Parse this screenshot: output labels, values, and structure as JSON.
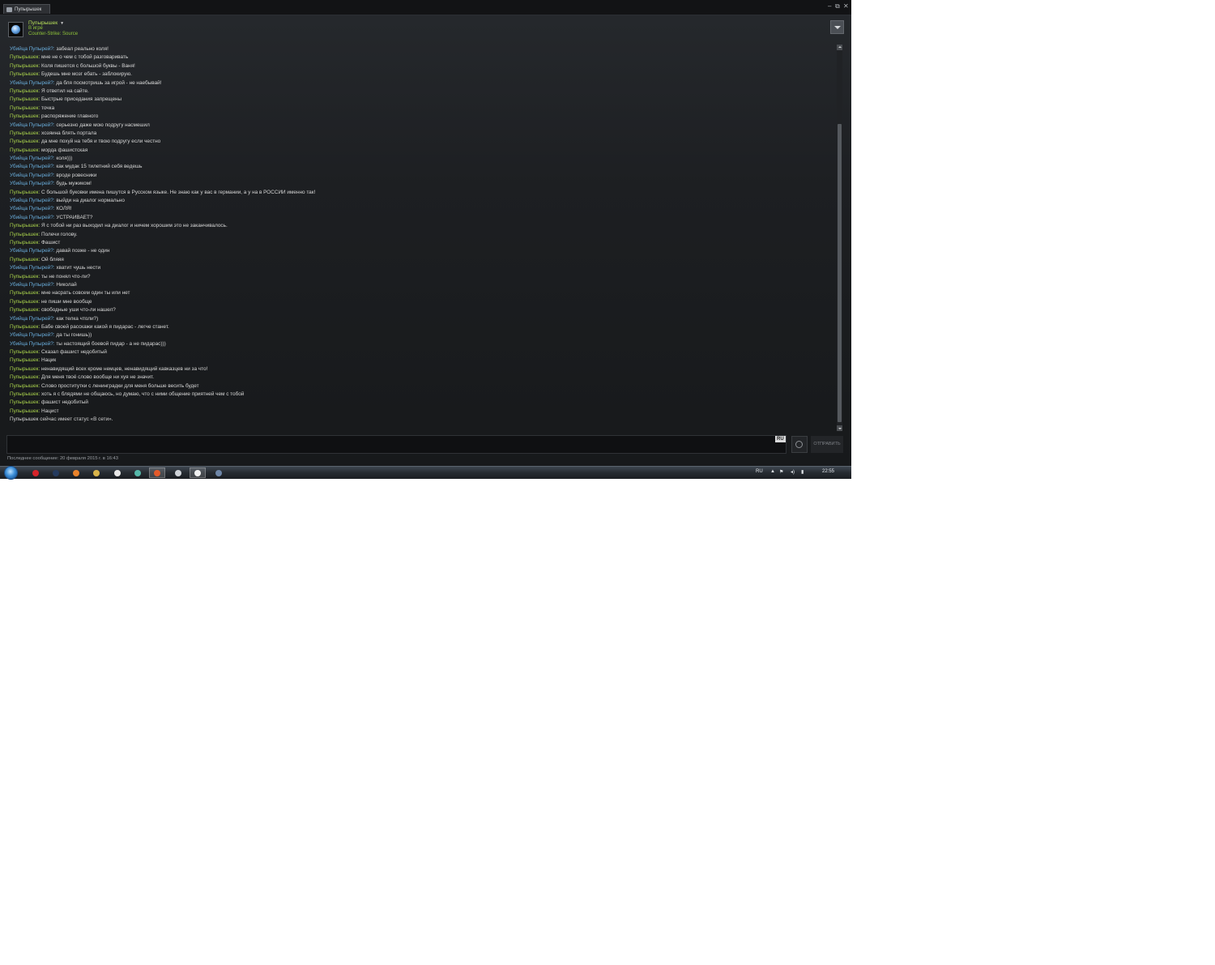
{
  "window": {
    "tab_title": "Пупырышек",
    "controls": {
      "minimize": "‒",
      "restore": "⧉",
      "close": "✕"
    }
  },
  "header": {
    "name": "Пупырышек",
    "status": "В игре",
    "game": "Counter-Strike: Source"
  },
  "colors": {
    "self_name": "#a7d04b",
    "friend_name": "#6aaedc",
    "message_text": "#d6d6d6",
    "background": "#1d1f22"
  },
  "messages": [
    {
      "type": "them",
      "sender": "Убийца Пупырей?",
      "text": "забеал реально коля!"
    },
    {
      "type": "me",
      "sender": "Пупырышек",
      "text": "мне не о чем с тобой разговаривать"
    },
    {
      "type": "me",
      "sender": "Пупырышек",
      "text": "Коля пишется с большой буквы - Ваня!"
    },
    {
      "type": "me",
      "sender": "Пупырышек",
      "text": "Будешь мне мозг ебать - заблокирую."
    },
    {
      "type": "them",
      "sender": "Убийца Пупырей?",
      "text": "да бля посмотришь за игрой - не наебывай!"
    },
    {
      "type": "me",
      "sender": "Пупырышек",
      "text": "Я ответил на сайте."
    },
    {
      "type": "me",
      "sender": "Пупырышек",
      "text": "Быстрые приседания запрещены"
    },
    {
      "type": "me",
      "sender": "Пупырышек",
      "text": "точка"
    },
    {
      "type": "me",
      "sender": "Пупырышек",
      "text": "распоряжение главного"
    },
    {
      "type": "them",
      "sender": "Убийца Пупырей?",
      "text": "серьезно даже мою подругу насмешил"
    },
    {
      "type": "me",
      "sender": "Пупырышек",
      "text": "хозяина блять портала"
    },
    {
      "type": "me",
      "sender": "Пупырышек",
      "text": "да мне похуй на тебя и твою подругу если честно"
    },
    {
      "type": "me",
      "sender": "Пупырышек",
      "text": "морда фашистская"
    },
    {
      "type": "them",
      "sender": "Убийца Пупырей?",
      "text": "коля)))"
    },
    {
      "type": "them",
      "sender": "Убийца Пупырей?",
      "text": "как мудак 15 тилетний себя ведешь"
    },
    {
      "type": "them",
      "sender": "Убийца Пупырей?",
      "text": "вроде ровесники"
    },
    {
      "type": "them",
      "sender": "Убийца Пупырей?",
      "text": "будь мужиком!"
    },
    {
      "type": "me",
      "sender": "Пупырышек",
      "text": "С большой буковки имена пишутся в Русском языке. Не знаю как у вас в германии, а у на в РОССИИ именно так!"
    },
    {
      "type": "them",
      "sender": "Убийца Пупырей?",
      "text": "выйди на диалог нормально"
    },
    {
      "type": "them",
      "sender": "Убийца Пупырей?",
      "text": "КОЛЯ!"
    },
    {
      "type": "them",
      "sender": "Убийца Пупырей?",
      "text": "УСТРАИВАЕТ?"
    },
    {
      "type": "me",
      "sender": "Пупырышек",
      "text": "Я с тобой ни раз выходил на диалог и ничем хорошим это не заканчивалось."
    },
    {
      "type": "me",
      "sender": "Пупырышек",
      "text": "Полечи голову."
    },
    {
      "type": "me",
      "sender": "Пупырышек",
      "text": "Фашист"
    },
    {
      "type": "them",
      "sender": "Убийца Пупырей?",
      "text": "давай позже - не один"
    },
    {
      "type": "me",
      "sender": "Пупырышек",
      "text": "Ой бляяя"
    },
    {
      "type": "them",
      "sender": "Убийца Пупырей?",
      "text": "хватит чушь нести"
    },
    {
      "type": "me",
      "sender": "Пупырышек",
      "text": "ты не понял что-ли?"
    },
    {
      "type": "them",
      "sender": "Убийца Пупырей?",
      "text": "Николай"
    },
    {
      "type": "me",
      "sender": "Пупырышек",
      "text": "мне насрать совсем один ты или нет"
    },
    {
      "type": "me",
      "sender": "Пупырышек",
      "text": "не пиши мне вообще"
    },
    {
      "type": "me",
      "sender": "Пупырышек",
      "text": "свободные уши что-ли нашел?"
    },
    {
      "type": "them",
      "sender": "Убийца Пупырей?",
      "text": "как телка чтоли?)"
    },
    {
      "type": "me",
      "sender": "Пупырышек",
      "text": "Бабе своей расскажи какой я пидарас - легче станет."
    },
    {
      "type": "them",
      "sender": "Убийца Пупырей?",
      "text": "да ты гонишь))"
    },
    {
      "type": "them",
      "sender": "Убийца Пупырей?",
      "text": "ты настоящий боевой пидар - а не пидарас)))"
    },
    {
      "type": "me",
      "sender": "Пупырышек",
      "text": "Сказал фашист недобитый"
    },
    {
      "type": "me",
      "sender": "Пупырышек",
      "text": "Нацик"
    },
    {
      "type": "me",
      "sender": "Пупырышек",
      "text": "ненавидящий всех кроме немцев, ненавидящий кавказцев ни за что!"
    },
    {
      "type": "me",
      "sender": "Пупырышек",
      "text": "Для меня твоё слово вообще ни хуя не значит."
    },
    {
      "type": "me",
      "sender": "Пупырышек",
      "text": "Слово проститутки с ленинградки для меня больше весить будет"
    },
    {
      "type": "me",
      "sender": "Пупырышек",
      "text": "хоть я с блядями не общаюсь, но думаю, что с ними общение приятней чем с тобой"
    },
    {
      "type": "me",
      "sender": "Пупырышек",
      "text": "фашист недобитый"
    },
    {
      "type": "me",
      "sender": "Пупырышек",
      "text": "Нацист"
    },
    {
      "type": "system",
      "sender": "",
      "text": "Пупырышек сейчас имеет статус «В сети»."
    }
  ],
  "composer": {
    "input_value": "",
    "lang_badge": "RU",
    "send_label": "ОТПРАВИТЬ"
  },
  "footer": {
    "last_message": "Последнее сообщение: 20 февраля 2015 г. в 16:43"
  },
  "taskbar": {
    "lang": "RU",
    "clock": "22:55",
    "apps": [
      {
        "icon": "opera-icon",
        "color": "#d6242a",
        "active": false
      },
      {
        "icon": "steam-icon",
        "color": "#243a5e",
        "active": false
      },
      {
        "icon": "firefox-icon",
        "color": "#e9822a",
        "active": false
      },
      {
        "icon": "folder-icon",
        "color": "#d9b44a",
        "active": false
      },
      {
        "icon": "skull-icon",
        "color": "#e8e8e8",
        "active": false
      },
      {
        "icon": "shield-icon",
        "color": "#55b7a9",
        "active": false
      },
      {
        "icon": "yandex-browser-icon",
        "color": "#e45a2a",
        "active": true
      },
      {
        "icon": "printer-icon",
        "color": "#cfd3d8",
        "active": false
      },
      {
        "icon": "document-icon",
        "color": "#f2f2f2",
        "active": true
      },
      {
        "icon": "steam-chat-icon",
        "color": "#6e86a8",
        "active": false
      }
    ]
  }
}
